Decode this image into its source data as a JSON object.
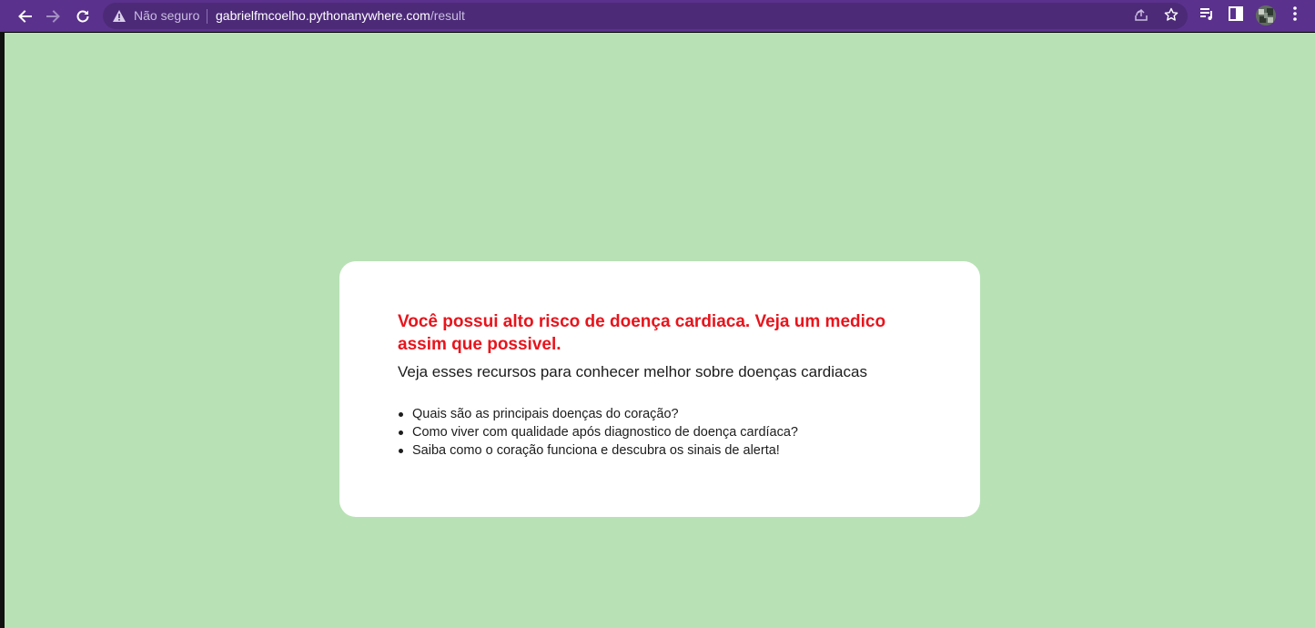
{
  "browser": {
    "security_label": "Não seguro",
    "url_host": "gabrielfmcoelho.pythonanywhere.com",
    "url_path": "/result",
    "toolbar_color": "#5a318c",
    "icons": {
      "back": "arrow-left-icon",
      "forward": "arrow-right-icon",
      "reload": "reload-icon",
      "warning": "warning-triangle-icon",
      "share": "share-icon",
      "bookmark": "star-icon",
      "reading_list": "reading-list-icon",
      "side_panel": "side-panel-icon",
      "menu": "kebab-menu-icon"
    }
  },
  "page": {
    "background_color": "#b8e2b5",
    "card": {
      "warning_title": "Você possui alto risco de doença cardiaca. Veja um medico assim que possivel.",
      "warning_color": "#e8141c",
      "subtitle": "Veja esses recursos para conhecer melhor sobre doenças cardiacas",
      "resources": [
        "Quais são as principais doenças do coração?",
        "Como viver com qualidade após diagnostico de doença cardíaca?",
        "Saiba como o coração funciona e descubra os sinais de alerta!"
      ]
    }
  }
}
